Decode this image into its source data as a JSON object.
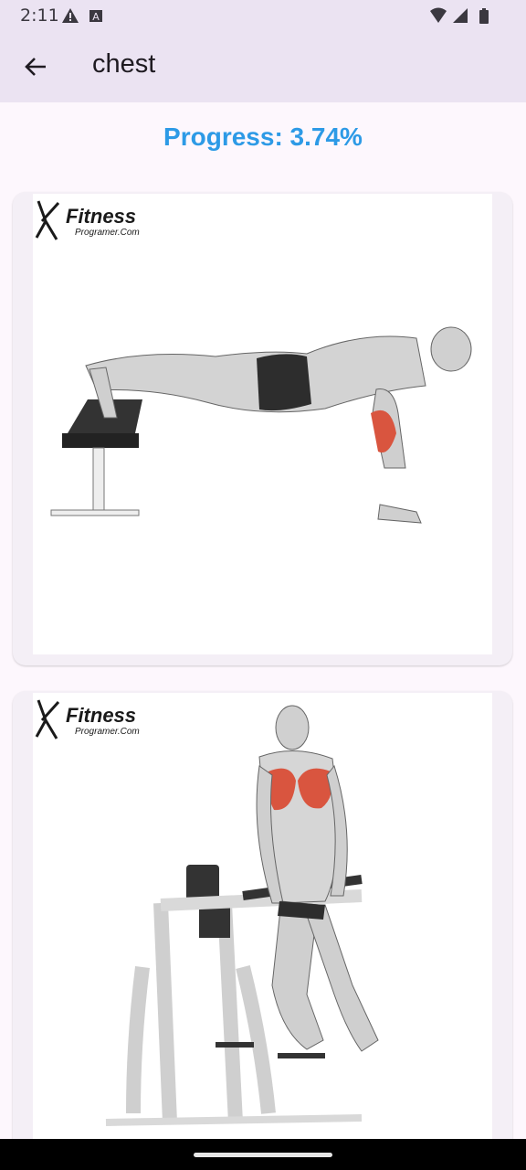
{
  "status_bar": {
    "time": "2:11"
  },
  "app_bar": {
    "title": "chest"
  },
  "progress": {
    "text": "Progress: 3.74%"
  },
  "exercises": [
    {
      "logo_text": "Fitness",
      "logo_sub": "Programer.Com"
    },
    {
      "logo_text": "Fitness",
      "logo_sub": "Programer.Com"
    }
  ],
  "colors": {
    "accent": "#2d9ae6",
    "app_bar": "#ebe3f2",
    "muscle_highlight": "#d9553f"
  }
}
